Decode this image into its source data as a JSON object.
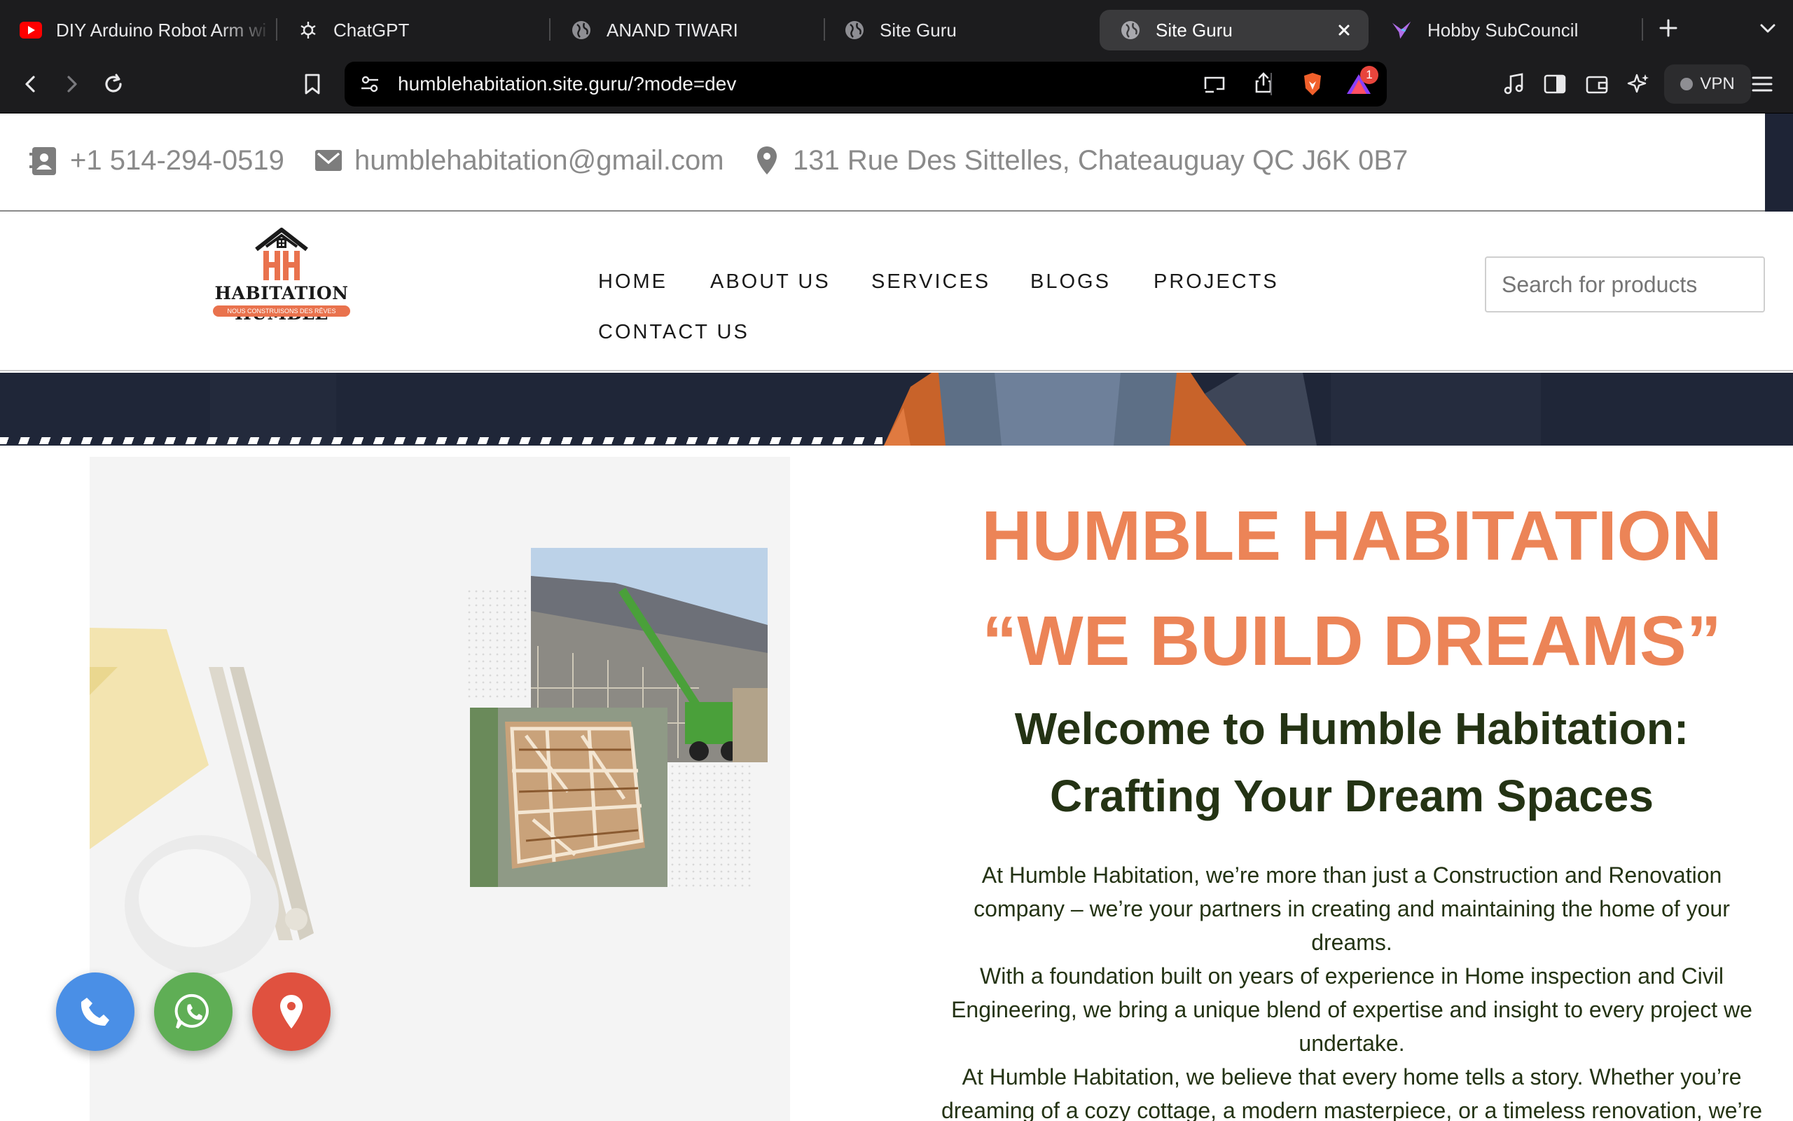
{
  "browser": {
    "tabs": [
      {
        "title": "DIY Arduino Robot Arm wi",
        "icon": "youtube-icon"
      },
      {
        "title": "ChatGPT",
        "icon": "chatgpt-icon"
      },
      {
        "title": "ANAND TIWARI",
        "icon": "globe-icon"
      },
      {
        "title": "Site Guru",
        "icon": "globe-icon"
      },
      {
        "title": "Site Guru",
        "icon": "globe-icon",
        "active": true
      },
      {
        "title": "Hobby SubCouncil",
        "icon": "hummingbird-icon"
      }
    ],
    "url": "humblehabitation.site.guru/?mode=dev",
    "notification_count": "1",
    "vpn_label": "VPN"
  },
  "contact_bar": {
    "phone": "+1 514-294-0519",
    "email": "humblehabitation@gmail.com",
    "address": "131 Rue Des Sittelles, Chateauguay QC J6K 0B7"
  },
  "logo": {
    "name": "HABITATION HUMBLE",
    "tagline": "NOUS CONSTRUISONS DES RÊVES"
  },
  "nav": {
    "home": "HOME",
    "about": "ABOUT US",
    "services": "SERVICES",
    "blogs": "BLOGS",
    "projects": "PROJECTS",
    "contact": "CONTACT US"
  },
  "search": {
    "placeholder": "Search for products"
  },
  "hero": {
    "title_line1": "HUMBLE HABITATION",
    "title_line2": "“WE BUILD DREAMS”",
    "subtitle_line1": "Welcome to Humble Habitation:",
    "subtitle_line2": "Crafting Your Dream Spaces",
    "p1_lines": [
      "At Humble Habitation, we’re more than just a Construction and Renovation",
      "company – we’re your partners in creating and maintaining the home of your",
      "dreams."
    ],
    "p2_lines": [
      "With a foundation built on years of experience in Home inspection and Civil",
      "Engineering, we bring a unique blend of expertise and insight to every project we",
      "undertake."
    ],
    "p3_lines": [
      "At Humble Habitation, we believe that every home tells a story. Whether you’re",
      "dreaming of a cozy cottage, a modern masterpiece, or a timeless renovation, we’re"
    ]
  },
  "colors": {
    "accent_orange": "#ec8457",
    "heading_green": "#243314",
    "phone_fab": "#4a8fe6",
    "whatsapp_fab": "#5fae55",
    "location_fab": "#e0513f"
  }
}
